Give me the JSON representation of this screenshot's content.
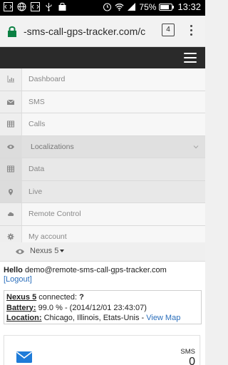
{
  "status_bar": {
    "battery_percent": "75%",
    "time": "13:32",
    "battery_level": 0.75
  },
  "browser": {
    "url": "-sms-call-gps-tracker.com/c",
    "tab_count": "4"
  },
  "menu": {
    "items": [
      {
        "label": "Dashboard",
        "icon": "bar-chart-icon"
      },
      {
        "label": "SMS",
        "icon": "envelope-icon"
      },
      {
        "label": "Calls",
        "icon": "table-icon"
      },
      {
        "label": "Localizations",
        "icon": "eye-icon"
      },
      {
        "label": "Data",
        "icon": "table-icon"
      },
      {
        "label": "Live",
        "icon": "map-marker-icon"
      },
      {
        "label": "Remote Control",
        "icon": "cloud-icon"
      },
      {
        "label": "My account",
        "icon": "gear-icon"
      }
    ]
  },
  "device": {
    "name": "Nexus 5"
  },
  "greeting": {
    "hello": "Hello",
    "email": "demo@remote-sms-call-gps-tracker.com",
    "logout": "[Logout]"
  },
  "info": {
    "device_name": "Nexus 5",
    "connected_text": "connected:",
    "connected_value": "?",
    "battery_label": "Battery:",
    "battery_value": "99.0 % - (2014/12/01 23:43:07)",
    "location_label": "Location:",
    "location_value": "Chicago, Illinois, Etats-Unis -",
    "view_map": "View Map"
  },
  "sms_card": {
    "title": "SMS",
    "count": "0"
  },
  "colors": {
    "navbar": "#2a2a2a",
    "link": "#2a6ebb",
    "card_icon": "#1e7bd8"
  }
}
